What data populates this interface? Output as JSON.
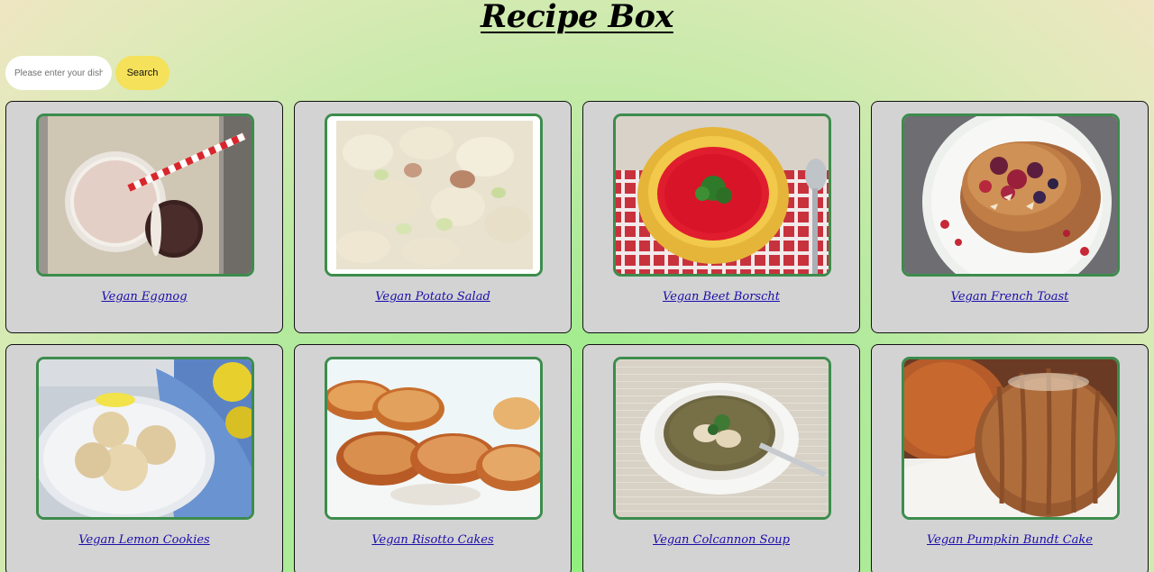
{
  "header": {
    "title": "Recipe Box"
  },
  "search": {
    "placeholder": "Please enter your dish",
    "button_label": "Search"
  },
  "recipes": [
    {
      "name": "Vegan Eggnog",
      "image_icon": "eggnog-photo"
    },
    {
      "name": "Vegan Potato Salad",
      "image_icon": "potato-salad-photo"
    },
    {
      "name": "Vegan Beet Borscht",
      "image_icon": "beet-borscht-photo"
    },
    {
      "name": "Vegan French Toast",
      "image_icon": "french-toast-photo"
    },
    {
      "name": "Vegan Lemon Cookies",
      "image_icon": "lemon-cookies-photo"
    },
    {
      "name": "Vegan Risotto Cakes",
      "image_icon": "risotto-cakes-photo"
    },
    {
      "name": "Vegan Colcannon Soup",
      "image_icon": "colcannon-soup-photo"
    },
    {
      "name": "Vegan Pumpkin Bundt Cake",
      "image_icon": "pumpkin-bundt-cake-photo"
    }
  ],
  "colors": {
    "card_bg": "#d3d3d3",
    "thumb_border": "#3c8c4c",
    "link": "#1a0dab",
    "search_button": "#f5e15a"
  }
}
